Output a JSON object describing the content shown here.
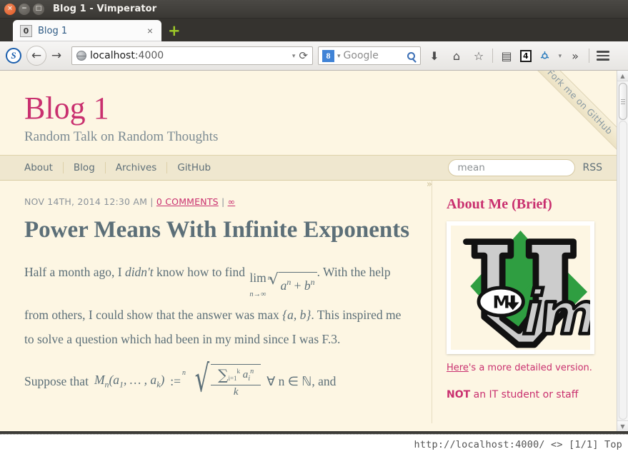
{
  "window": {
    "title": "Blog 1 - Vimperator",
    "buttons": {
      "close": "×",
      "minimize": "−",
      "maximize": "□"
    }
  },
  "tabbar": {
    "tab": {
      "number": "0",
      "label": "Blog 1",
      "close": "×"
    },
    "new_tab": "+"
  },
  "toolbar": {
    "extension_icon_letter": "S",
    "back": "←",
    "forward": "→",
    "url_host": "localhost",
    "url_port": ":4000",
    "url_dropdown": "▾",
    "reload": "⟳",
    "search_engine_letter": "8",
    "search_engine_caret": "▾",
    "search_placeholder": "Google",
    "download_icon": "⬇",
    "home_icon": "⌂",
    "bookmark_icon": "☆",
    "reader_icon": "▤",
    "addon_badge": "4",
    "addon_caret": "▾",
    "overflow_icon": "»",
    "menu_icon": "hamburger"
  },
  "site": {
    "title": "Blog 1",
    "subtitle": "Random Talk on Random Thoughts",
    "nav": [
      "About",
      "Blog",
      "Archives",
      "GitHub"
    ],
    "search_value": "mean",
    "rss_label": "RSS",
    "ribbon": "Fork me on GitHub",
    "sidebar_toggle": "»"
  },
  "post": {
    "date": "NOV 14TH, 2014 12:30 AM",
    "sep1": "|",
    "comments": "0 COMMENTS",
    "sep2": "|",
    "permalink": "∞",
    "title": "Power Means With Infinite Exponents",
    "p1_a": "Half a month ago, I ",
    "p1_italic": "didn't",
    "p1_b": " know how to find ",
    "p1_lim_op": "lim",
    "p1_lim_sub": "n→∞",
    "p1_root_index": "n",
    "p1_radicand_a": "a",
    "p1_radicand_a_exp": "n",
    "p1_plus": " + ",
    "p1_radicand_b": "b",
    "p1_radicand_b_exp": "n",
    "p1_c": ". With the help from others, I could show that the answer was max ",
    "p1_max_set": "{a, b}",
    "p1_d": ". This inspired me to solve a question which had been in my mind since I was F.3.",
    "p2_a": "Suppose that ",
    "p2_M": "M",
    "p2_M_sub": "n",
    "p2_args": "(a",
    "p2_arg1_sub": "1",
    "p2_args_mid": ", … , a",
    "p2_argk_sub": "k",
    "p2_args_end": ")",
    "p2_assign": " := ",
    "p2_root_index": "n",
    "p2_sum": "∑",
    "p2_sum_lower": "i=1",
    "p2_sum_upper": "k",
    "p2_sum_body_a": "a",
    "p2_sum_body_sub": "i",
    "p2_sum_body_exp": "n",
    "p2_denom": "k",
    "p2_forall": "∀ n ∈ ℕ, and"
  },
  "sidebar": {
    "heading": "About Me (Brief)",
    "image_alt": "vim-markdown-logo",
    "link_text": "Here",
    "link_rest": "'s a more detailed version.",
    "note_bold": "NOT",
    "note_rest": " an IT student or staff"
  },
  "statusbar": {
    "text": "http://localhost:4000/ <> [1/1] Top"
  },
  "colors": {
    "page_bg": "#fdf6e3",
    "accent_pink": "#c9306f",
    "body_slate": "#5c6f78",
    "nav_strip": "#efe7cf"
  }
}
